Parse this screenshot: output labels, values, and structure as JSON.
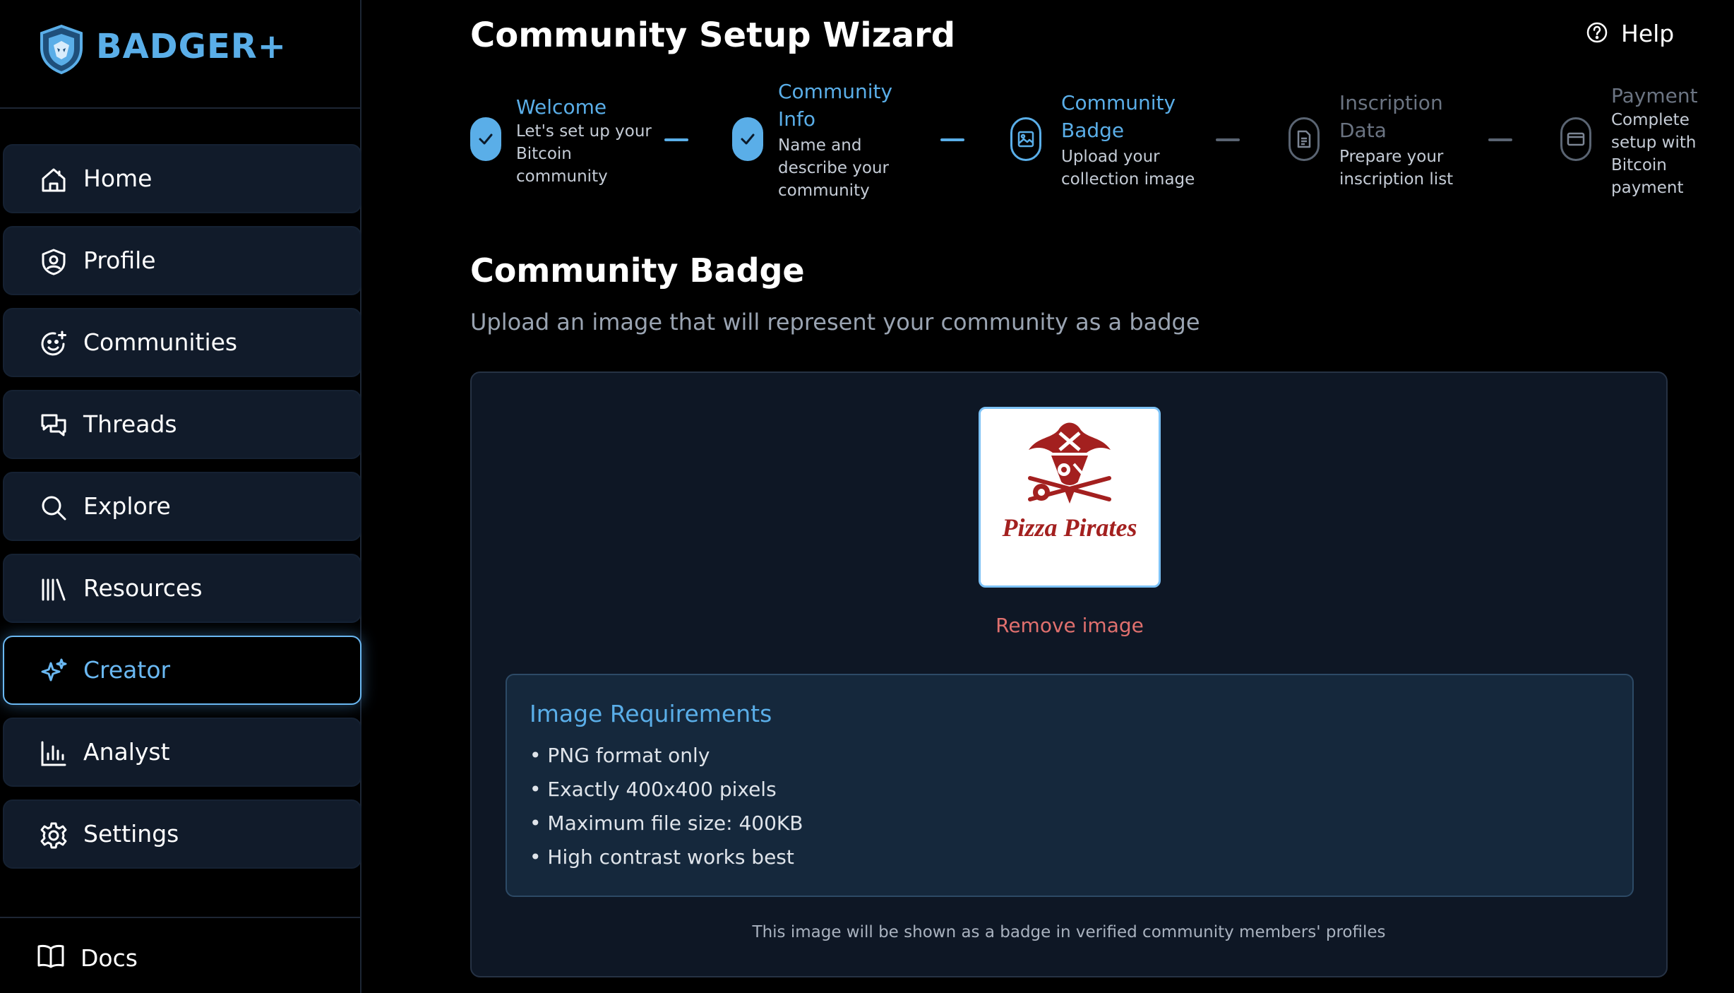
{
  "app": {
    "name": "BADGER+"
  },
  "sidebar": {
    "items": [
      {
        "label": "Home",
        "icon": "home-icon",
        "active": false
      },
      {
        "label": "Profile",
        "icon": "profile-shield-icon",
        "active": false
      },
      {
        "label": "Communities",
        "icon": "smiley-plus-icon",
        "active": false
      },
      {
        "label": "Threads",
        "icon": "chat-bubbles-icon",
        "active": false
      },
      {
        "label": "Explore",
        "icon": "search-icon",
        "active": false
      },
      {
        "label": "Resources",
        "icon": "library-icon",
        "active": false
      },
      {
        "label": "Creator",
        "icon": "sparkles-icon",
        "active": true
      },
      {
        "label": "Analyst",
        "icon": "bar-chart-icon",
        "active": false
      },
      {
        "label": "Settings",
        "icon": "gear-icon",
        "active": false
      }
    ],
    "docs": {
      "label": "Docs",
      "icon": "book-icon"
    }
  },
  "header": {
    "title": "Community Setup Wizard",
    "help_label": "Help"
  },
  "wizard": {
    "steps": [
      {
        "title": "Welcome",
        "description": "Let's set up your Bitcoin community",
        "status": "completed",
        "icon": "check-icon"
      },
      {
        "title": "Community Info",
        "description": "Name and describe your community",
        "status": "completed",
        "icon": "check-icon"
      },
      {
        "title": "Community Badge",
        "description": "Upload your collection image",
        "status": "current",
        "icon": "image-icon"
      },
      {
        "title": "Inscription Data",
        "description": "Prepare your inscription list",
        "status": "upcoming",
        "icon": "document-icon"
      },
      {
        "title": "Payment",
        "description": "Complete setup with Bitcoin payment",
        "status": "upcoming",
        "icon": "credit-card-icon"
      }
    ]
  },
  "badge_section": {
    "title": "Community Badge",
    "subtitle": "Upload an image that will represent your community as a badge",
    "image_text": "Pizza Pirates",
    "remove_label": "Remove image",
    "requirements": {
      "title": "Image Requirements",
      "items": [
        "• PNG format only",
        "• Exactly 400x400 pixels",
        "• Maximum file size: 400KB",
        "• High contrast works best"
      ]
    },
    "footnote": "This image will be shown as a badge in verified community members' profiles"
  },
  "colors": {
    "accent": "#5aaee8",
    "background": "#000000",
    "panel": "#0e1725",
    "remove": "#e0706e",
    "badge_red": "#a3201f"
  }
}
